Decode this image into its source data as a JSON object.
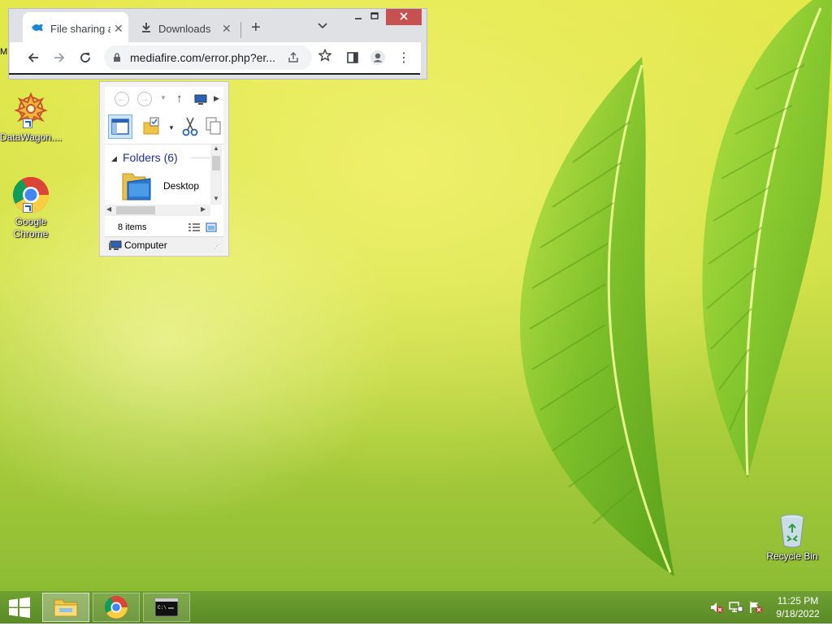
{
  "desktop": {
    "icons": [
      {
        "label": "DataWagon....",
        "icon": "datawagon-icon"
      },
      {
        "label": "Google Chrome",
        "line1": "Google",
        "line2": "Chrome",
        "icon": "chrome-icon"
      },
      {
        "label": "Recycle Bin",
        "icon": "recycle-bin-icon"
      }
    ],
    "edge_text": "M"
  },
  "browser": {
    "tabs": [
      {
        "title": "File sharing a",
        "icon": "mediafire-icon",
        "active": true,
        "close": "✕"
      },
      {
        "title": "Downloads",
        "icon": "download-icon",
        "active": false,
        "close": "✕"
      }
    ],
    "new_tab": "+",
    "tab_search": "⌄",
    "window_controls": {
      "minimize": "—",
      "maximize": "☐",
      "close": "✕"
    },
    "nav": {
      "back": "←",
      "forward": "→",
      "reload": "↻",
      "menu": "⋮"
    },
    "url": "mediafire.com/error.php?er..."
  },
  "explorer": {
    "group_header": "Folders (6)",
    "item_name": "Desktop",
    "item_count": "8 items",
    "location": "Computer"
  },
  "taskbar": {
    "apps": [
      {
        "name": "File Explorer",
        "active": true
      },
      {
        "name": "Google Chrome",
        "active": false
      },
      {
        "name": "Command Prompt",
        "active": false
      }
    ],
    "clock": {
      "time": "11:25 PM",
      "date": "9/18/2022"
    }
  }
}
